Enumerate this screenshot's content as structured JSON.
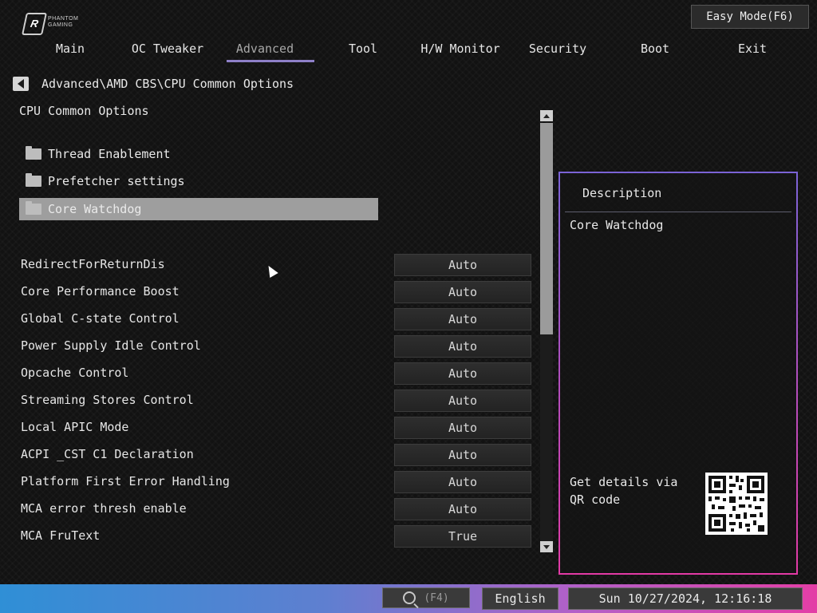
{
  "brand": {
    "line1": "PHANTOM",
    "line2": "GAMING"
  },
  "easy_mode": "Easy Mode(F6)",
  "nav": {
    "tabs": [
      "Main",
      "OC Tweaker",
      "Advanced",
      "Tool",
      "H/W Monitor",
      "Security",
      "Boot",
      "Exit"
    ],
    "active": "Advanced"
  },
  "breadcrumb": "Advanced\\AMD CBS\\CPU Common Options",
  "section_title": "CPU Common Options",
  "submenus": [
    "Thread Enablement",
    "Prefetcher settings",
    "Core Watchdog"
  ],
  "selected_submenu": "Core Watchdog",
  "options": [
    {
      "label": "RedirectForReturnDis",
      "value": "Auto"
    },
    {
      "label": "Core Performance Boost",
      "value": "Auto"
    },
    {
      "label": "Global C-state Control",
      "value": "Auto"
    },
    {
      "label": "Power Supply Idle Control",
      "value": "Auto"
    },
    {
      "label": "Opcache Control",
      "value": "Auto"
    },
    {
      "label": "Streaming Stores Control",
      "value": "Auto"
    },
    {
      "label": "Local APIC Mode",
      "value": "Auto"
    },
    {
      "label": "ACPI _CST C1 Declaration",
      "value": "Auto"
    },
    {
      "label": "Platform First Error Handling",
      "value": "Auto"
    },
    {
      "label": "MCA error thresh enable",
      "value": "Auto"
    },
    {
      "label": "MCA FruText",
      "value": "True"
    }
  ],
  "description": {
    "heading": "Description",
    "text": "Core Watchdog",
    "qr_prompt": "Get details via QR code"
  },
  "bottom_bar": {
    "search_key": "(F4)",
    "language": "English",
    "datetime": "Sun 10/27/2024, 12:16:18"
  },
  "colors": {
    "accent_tab": "#8e80c8",
    "panel_border_top": "#7b63d6",
    "panel_border_bottom": "#e23aa5"
  }
}
